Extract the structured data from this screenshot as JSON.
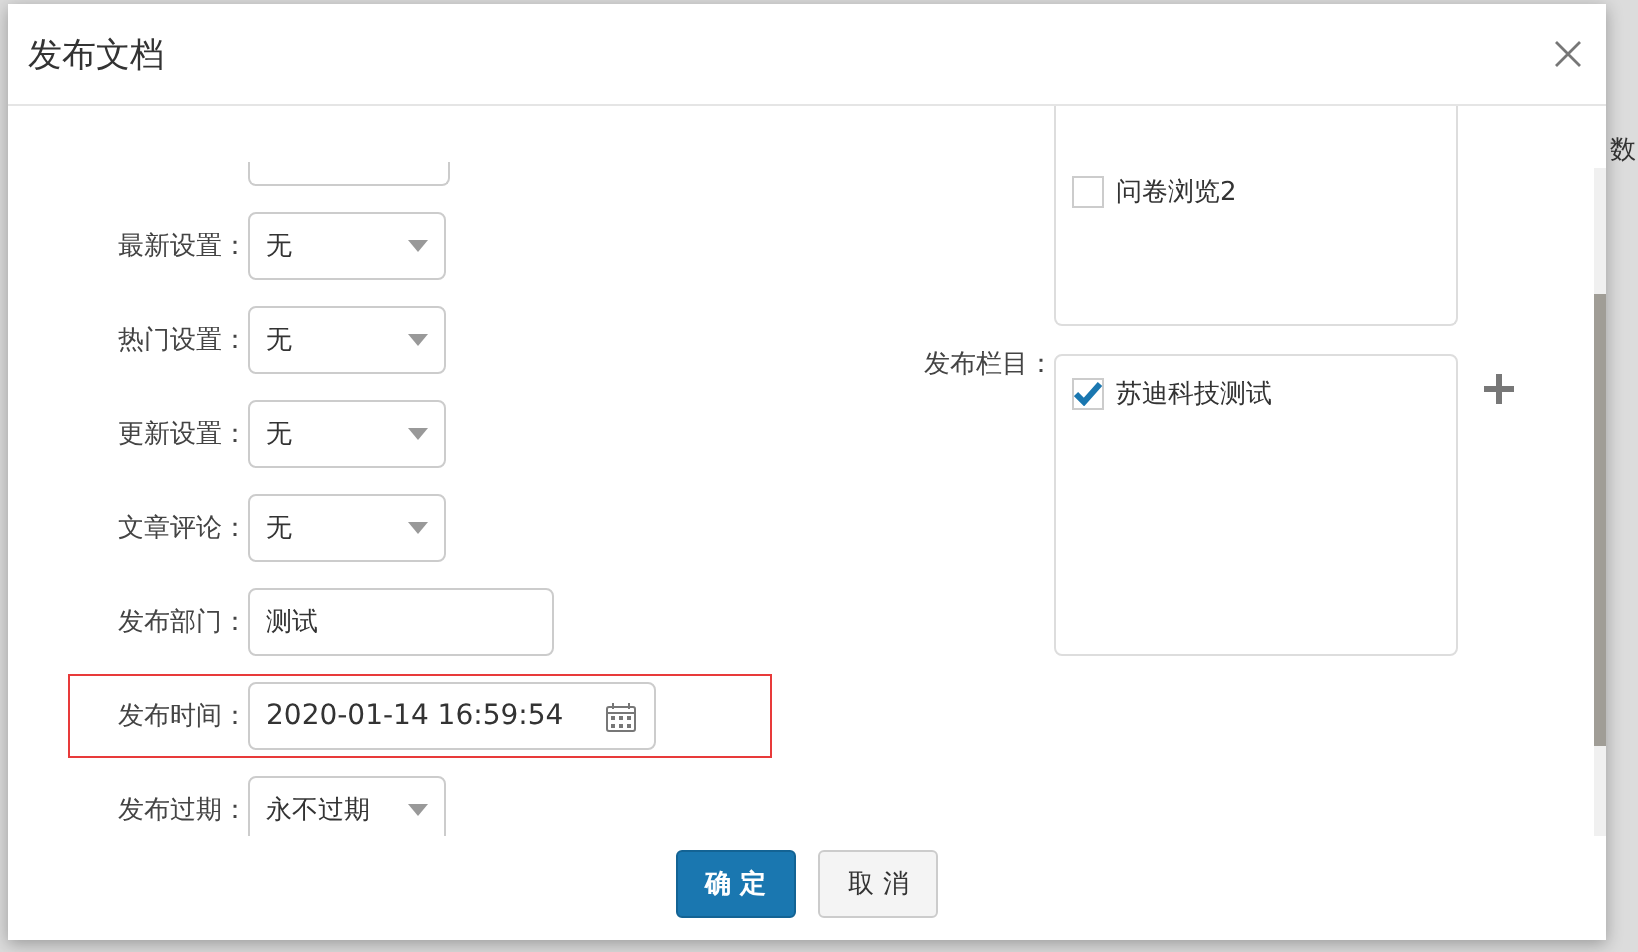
{
  "background": {
    "column_header": "数"
  },
  "dialog": {
    "title": "发布文档",
    "fields": [
      {
        "label": "最新设置：",
        "kind": "select",
        "value": "无",
        "highlighted": false
      },
      {
        "label": "热门设置：",
        "kind": "select",
        "value": "无",
        "highlighted": false
      },
      {
        "label": "更新设置：",
        "kind": "select",
        "value": "无",
        "highlighted": false
      },
      {
        "label": "文章评论：",
        "kind": "select",
        "value": "无",
        "highlighted": false
      },
      {
        "label": "发布部门：",
        "kind": "text",
        "value": "测试",
        "highlighted": false
      },
      {
        "label": "发布时间：",
        "kind": "date",
        "value": "2020-01-14 16:59:54",
        "highlighted": true
      },
      {
        "label": "发布过期：",
        "kind": "select",
        "value": "永不过期",
        "highlighted": false
      }
    ],
    "column_lists": [
      {
        "items": [
          {
            "label": "问卷浏览2",
            "checked": false
          }
        ]
      },
      {
        "label": "发布栏目：",
        "items": [
          {
            "label": "苏迪科技测试",
            "checked": true
          }
        ]
      }
    ],
    "buttons": [
      {
        "label": "确 定",
        "kind": "primary"
      },
      {
        "label": "取 消",
        "kind": "default"
      }
    ]
  }
}
